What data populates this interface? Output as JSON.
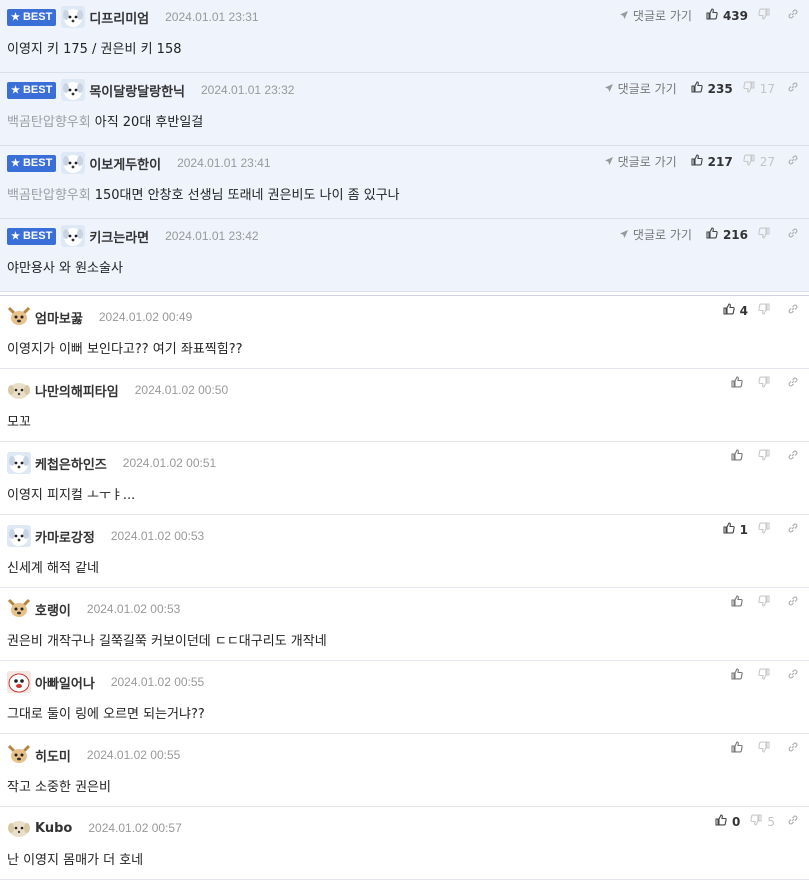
{
  "reply_label": "댓글로 가기",
  "best_label": "BEST",
  "best": [
    {
      "nick": "디프리미엄",
      "date": "2024.01.01 23:31",
      "group": "",
      "text": "이영지 키 175 / 권은비 키 158",
      "likes": "439",
      "dislikes": ""
    },
    {
      "nick": "목이달랑달랑한닉",
      "date": "2024.01.01 23:32",
      "group": "백곰탄압향우회",
      "text": "아직 20대 후반일걸",
      "likes": "235",
      "dislikes": "17"
    },
    {
      "nick": "이보게두한이",
      "date": "2024.01.01 23:41",
      "group": "백곰탄압향우회",
      "text": "150대면 안창호 선생님 또래네 권은비도 나이 좀 있구나",
      "likes": "217",
      "dislikes": "27"
    },
    {
      "nick": "키크는라면",
      "date": "2024.01.01 23:42",
      "group": "",
      "text": "야만용사 와 원소술사",
      "likes": "216",
      "dislikes": ""
    }
  ],
  "comments": [
    {
      "nick": "엄마보꿇",
      "date": "2024.01.02 00:49",
      "text": "이영지가 이뻐 보인다고?? 여기 좌표찍힘??",
      "likes": "4",
      "dislikes": "",
      "avatar": "chihuahua"
    },
    {
      "nick": "나만의해피타임",
      "date": "2024.01.02 00:50",
      "text": "모꼬",
      "likes": "",
      "dislikes": "",
      "avatar": "puppy"
    },
    {
      "nick": "케첩은하인즈",
      "date": "2024.01.02 00:51",
      "text": "이영지 피지컬 ㅗㅜㅑ...",
      "likes": "",
      "dislikes": "",
      "avatar": "dog"
    },
    {
      "nick": "카마로강정",
      "date": "2024.01.02 00:53",
      "text": "신세계 해적 같네",
      "likes": "1",
      "dislikes": "",
      "avatar": "dog"
    },
    {
      "nick": "호랭이",
      "date": "2024.01.02 00:53",
      "text": "권은비 개작구나 길쭉길쭉 커보이던데 ㄷㄷ대구리도 개작네",
      "likes": "",
      "dislikes": "",
      "avatar": "chihuahua"
    },
    {
      "nick": "아빠일어나",
      "date": "2024.01.02 00:55",
      "text": "그대로 둘이 링에 오르면 되는거냐??",
      "likes": "",
      "dislikes": "",
      "avatar": "redpuppy"
    },
    {
      "nick": "히도미",
      "date": "2024.01.02 00:55",
      "text": "작고 소중한 권은비",
      "likes": "",
      "dislikes": "",
      "avatar": "chihuahua"
    },
    {
      "nick": "Kubo",
      "date": "2024.01.02 00:57",
      "text": "난 이영지 몸매가 더 호네",
      "likes": "0",
      "dislikes": "5",
      "avatar": "puppy"
    }
  ]
}
